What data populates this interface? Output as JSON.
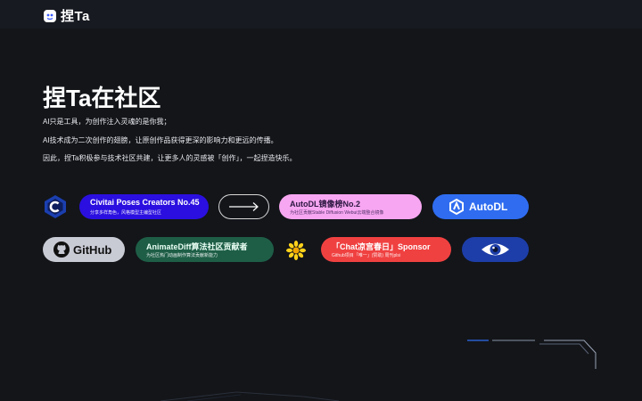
{
  "header": {
    "logo_text": "捏Ta"
  },
  "hero": {
    "title": "捏Ta在社区",
    "lines": [
      "AI只是工具，为创作注入灵魂的是你我；",
      "AI技术成为二次创作的翅膀，让原创作品获得更深的影响力和更远的传播。",
      "因此，捏Ta积极参与技术社区共建，让更多人的灵感被「创作」，一起捏造快乐。"
    ]
  },
  "partners": {
    "civitai": {
      "title": "Civitai Poses Creators No.45",
      "subtitle": "分享多样角色，风格模型主编型社区"
    },
    "autodl_rank": {
      "title": "AutoDL镜像榜No.2",
      "subtitle": "为社区贡献Stable Diffusion Webui云端整合镜像"
    },
    "autodl": {
      "label": "AutoDL"
    },
    "github": {
      "label": "GitHub"
    },
    "animatediff": {
      "title": "AnimateDiff算法社区贡献者",
      "subtitle": "为社区热门动画制作算法贡献新能力"
    },
    "chat": {
      "title": "「Chat凉宫春日」Sponsor",
      "subtitle": "Github项目「唯一」(赞助) 周刊plsi"
    }
  },
  "colors": {
    "background": "#131519",
    "civitai": "#2a0fe0",
    "autodl_rank": "#f7a6f1",
    "autodl": "#2f6cf0",
    "github": "#c8cad4",
    "animatediff": "#1e5e47",
    "chat": "#f04141",
    "eye": "#1d3ea8"
  },
  "icons": [
    "civitai-logo-icon",
    "arrow-right-icon",
    "autodl-logo-icon",
    "github-icon",
    "sunflower-icon",
    "eye-icon"
  ]
}
